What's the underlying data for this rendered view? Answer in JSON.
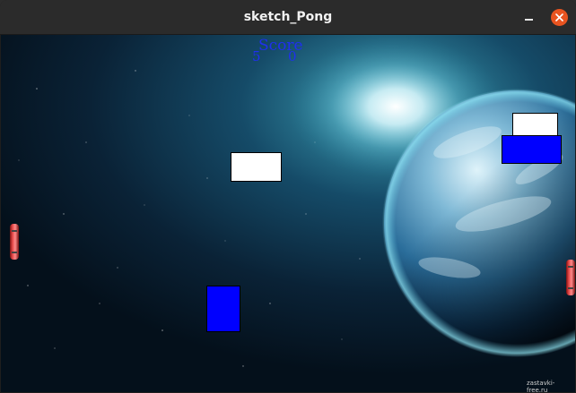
{
  "window": {
    "title": "sketch_Pong"
  },
  "icons": {
    "minimize": "minimize-icon",
    "close": "close-icon"
  },
  "colors": {
    "titlebar": "#2b2b2b",
    "close_button": "#e95420",
    "score_text": "#1f2ff0",
    "white_block": "#ffffff",
    "blue_block": "#0000ff"
  },
  "game": {
    "score_label": "Score",
    "score_left": "5",
    "score_right": "0",
    "watermark": "zastavki-free.ru"
  }
}
